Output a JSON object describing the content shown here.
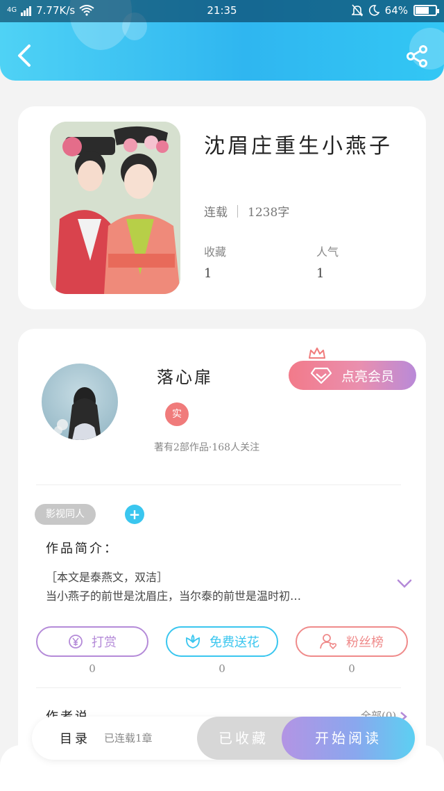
{
  "status_bar": {
    "network": "4G",
    "speed": "7.77K/s",
    "time": "21:35",
    "battery": "64%"
  },
  "book": {
    "title": "沈眉庄重生小燕子",
    "status": "连载",
    "word_count": "1238字",
    "favorites_label": "收藏",
    "favorites_value": "1",
    "popularity_label": "人气",
    "popularity_value": "1"
  },
  "author": {
    "name": "落心扉",
    "real_badge": "实",
    "meta": "著有2部作品·168人关注",
    "vip_button": "点亮会员"
  },
  "tags": {
    "tag": "影视同人",
    "add_icon": "+"
  },
  "intro": {
    "title": "作品简介：",
    "line1": "［本文是泰燕文，双洁］",
    "line2": "当小燕子的前世是沈眉庄，当尔泰的前世是温时初…"
  },
  "actions": [
    {
      "label": "打赏",
      "count": "0",
      "color": "#b48ad8"
    },
    {
      "label": "免费送花",
      "count": "0",
      "color": "#3ac6ef"
    },
    {
      "label": "粉丝榜",
      "count": "0",
      "color": "#ef8a8a"
    }
  ],
  "author_says": {
    "title": "作者说",
    "all": "全部(0)"
  },
  "bottom_bar": {
    "toc": "目录",
    "chapters": "已连载1章",
    "favorited": "已收藏",
    "start_reading": "开始阅读"
  },
  "colors": {
    "header": "#2fb6f0",
    "accent_pink": "#f27a8a",
    "accent_purple": "#b98ad8"
  }
}
